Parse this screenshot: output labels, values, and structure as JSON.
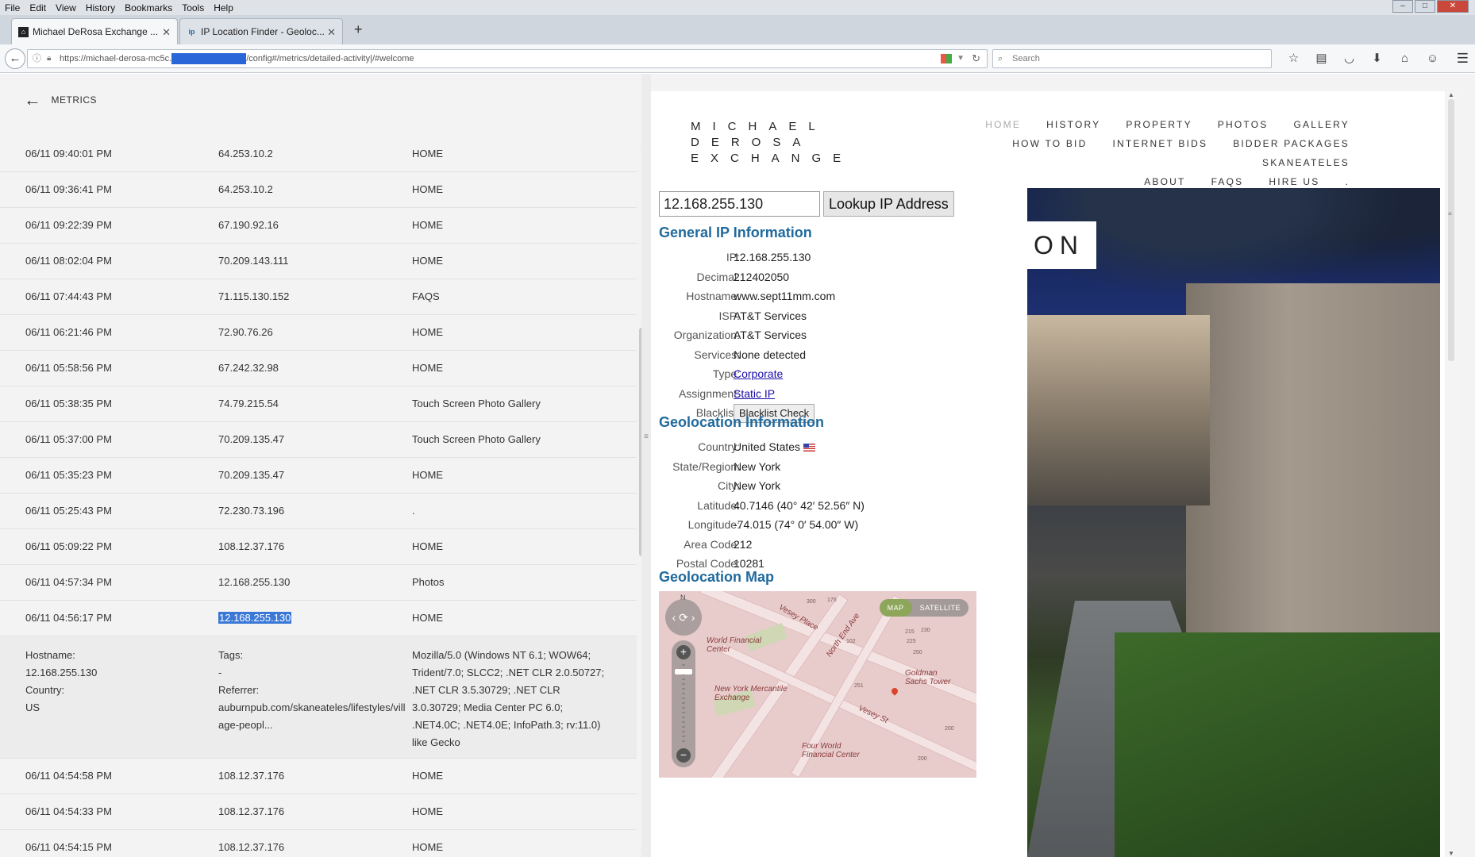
{
  "menubar": {
    "items": [
      "File",
      "Edit",
      "View",
      "History",
      "Bookmarks",
      "Tools",
      "Help"
    ]
  },
  "tabs": [
    {
      "title": "Michael DeRosa Exchange ...",
      "active": true
    },
    {
      "title": "IP Location Finder - Geoloc...",
      "active": false
    }
  ],
  "newtab_icon": "+",
  "nav": {
    "url_prefix": "https://michael-derosa-mc5c.",
    "url_suffix": "/config#/metrics/detailed-activity|/#welcome",
    "search_placeholder": "Search"
  },
  "metrics": {
    "back_label": "METRICS",
    "rows_top": [
      {
        "time": "06/11   09:40:01 PM",
        "ip": "64.253.10.2",
        "page": "HOME"
      },
      {
        "time": "06/11   09:36:41 PM",
        "ip": "64.253.10.2",
        "page": "HOME"
      },
      {
        "time": "06/11   09:22:39 PM",
        "ip": "67.190.92.16",
        "page": "HOME"
      },
      {
        "time": "06/11   08:02:04 PM",
        "ip": "70.209.143.111",
        "page": "HOME"
      },
      {
        "time": "06/11   07:44:43 PM",
        "ip": "71.115.130.152",
        "page": "FAQS"
      },
      {
        "time": "06/11   06:21:46 PM",
        "ip": "72.90.76.26",
        "page": "HOME"
      },
      {
        "time": "06/11   05:58:56 PM",
        "ip": "67.242.32.98",
        "page": "HOME"
      },
      {
        "time": "06/11   05:38:35 PM",
        "ip": "74.79.215.54",
        "page": "Touch Screen Photo Gallery"
      },
      {
        "time": "06/11   05:37:00 PM",
        "ip": "70.209.135.47",
        "page": "Touch Screen Photo Gallery"
      },
      {
        "time": "06/11   05:35:23 PM",
        "ip": "70.209.135.47",
        "page": "HOME"
      },
      {
        "time": "06/11   05:25:43 PM",
        "ip": "72.230.73.196",
        "page": "."
      },
      {
        "time": "06/11   05:09:22 PM",
        "ip": "108.12.37.176",
        "page": "HOME"
      },
      {
        "time": "06/11   04:57:34 PM",
        "ip": "12.168.255.130",
        "page": "Photos"
      }
    ],
    "selected_row": {
      "time": "06/11   04:56:17 PM",
      "ip": "12.168.255.130",
      "page": "HOME"
    },
    "detail": {
      "hostname_label": "Hostname:",
      "hostname": "12.168.255.130",
      "country_label": "Country:",
      "country": "US",
      "tags_label": "Tags:",
      "tags": "-",
      "referrer_label": "Referrer:",
      "referrer": "auburnpub.com/skaneateles/lifestyles/village-peopl...",
      "user_agent": "Mozilla/5.0 (Windows NT 6.1; WOW64; Trident/7.0; SLCC2; .NET CLR 2.0.50727; .NET CLR 3.5.30729; .NET CLR 3.0.30729; Media Center PC 6.0; .NET4.0C; .NET4.0E; InfoPath.3; rv:11.0) like Gecko"
    },
    "rows_bottom": [
      {
        "time": "06/11   04:54:58 PM",
        "ip": "108.12.37.176",
        "page": "HOME"
      },
      {
        "time": "06/11   04:54:33 PM",
        "ip": "108.12.37.176",
        "page": "HOME"
      },
      {
        "time": "06/11   04:54:15 PM",
        "ip": "108.12.37.176",
        "page": "HOME"
      }
    ]
  },
  "site": {
    "logo_lines": [
      "MICHAEL",
      "DEROSA",
      "EXCHANGE"
    ],
    "nav_rows": [
      [
        "HOME",
        "HISTORY",
        "PROPERTY",
        "PHOTOS",
        "GALLERY"
      ],
      [
        "HOW TO BID",
        "INTERNET BIDS",
        "BIDDER PACKAGES",
        "SKANEATELES"
      ],
      [
        "ABOUT",
        "FAQS",
        "HIRE US",
        "."
      ]
    ],
    "hero_text": "ON"
  },
  "iplookup": {
    "input_value": "12.168.255.130",
    "button_label": "Lookup IP Address",
    "general_title": "General IP Information",
    "general": [
      {
        "k": "IP:",
        "v": "12.168.255.130"
      },
      {
        "k": "Decimal:",
        "v": "212402050"
      },
      {
        "k": "Hostname:",
        "v": "www.sept11mm.com"
      },
      {
        "k": "ISP:",
        "v": "AT&T Services"
      },
      {
        "k": "Organization:",
        "v": "AT&T Services"
      },
      {
        "k": "Services:",
        "v": "None detected"
      },
      {
        "k": "Type:",
        "v": "Corporate",
        "link": true
      },
      {
        "k": "Assignment:",
        "v": "Static IP",
        "link": true
      },
      {
        "k": "Blacklist:",
        "v": "Blacklist Check",
        "button": true
      }
    ],
    "geo_title": "Geolocation Information",
    "geo": [
      {
        "k": "Country:",
        "v": "United States",
        "flag": true
      },
      {
        "k": "State/Region:",
        "v": "New York"
      },
      {
        "k": "City:",
        "v": "New York"
      },
      {
        "k": "Latitude:",
        "v": "40.7146  (40° 42′ 52.56″ N)"
      },
      {
        "k": "Longitude:",
        "v": "-74.015  (74° 0′ 54.00″ W)"
      },
      {
        "k": "Area Code:",
        "v": "212"
      },
      {
        "k": "Postal Code:",
        "v": "10281"
      }
    ],
    "map_title": "Geolocation Map",
    "map": {
      "toggle_map": "MAP",
      "toggle_satellite": "SATELLITE",
      "compass_n": "N",
      "labels": [
        "World Financial Center",
        "New York Mercantile Exchange",
        "Four World Financial Center",
        "Goldman Sachs Tower",
        "Vesey Place",
        "North End Ave",
        "Vesey St"
      ],
      "numbers": [
        "300",
        "175",
        "102",
        "215",
        "225",
        "230",
        "250",
        "251",
        "200",
        "200",
        "230"
      ]
    }
  }
}
